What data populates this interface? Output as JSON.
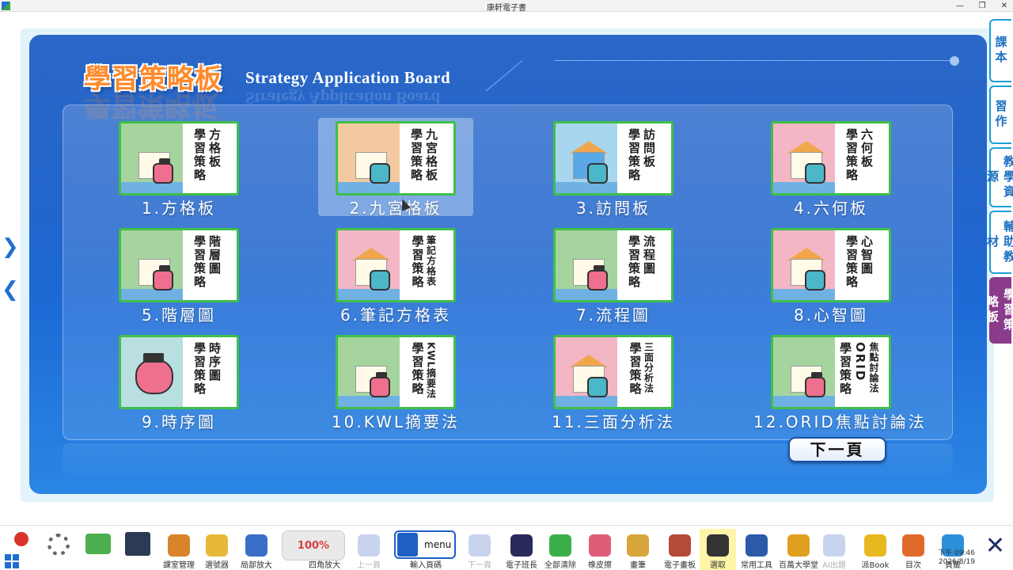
{
  "window": {
    "title": "康軒電子書"
  },
  "board": {
    "title_zh": "學習策略板",
    "title_en": "Strategy Application Board",
    "next_button": "下一頁"
  },
  "strategies": [
    {
      "label": "1.方格板",
      "thumb_cols": [
        "方格板",
        "學習策略"
      ],
      "art": "green"
    },
    {
      "label": "2.九宮格板",
      "thumb_cols": [
        "九宮格板",
        "學習策略"
      ],
      "art": "peach"
    },
    {
      "label": "3.訪問板",
      "thumb_cols": [
        "訪問板",
        "學習策略"
      ],
      "art": "blue"
    },
    {
      "label": "4.六何板",
      "thumb_cols": [
        "六何板",
        "學習策略"
      ],
      "art": "pink"
    },
    {
      "label": "5.階層圖",
      "thumb_cols": [
        "階層圖",
        "學習策略"
      ],
      "art": "green"
    },
    {
      "label": "6.筆記方格表",
      "thumb_cols": [
        "筆記方格表",
        "學習策略"
      ],
      "art": "pink"
    },
    {
      "label": "7.流程圖",
      "thumb_cols": [
        "流程圖",
        "學習策略"
      ],
      "art": "green"
    },
    {
      "label": "8.心智圖",
      "thumb_cols": [
        "心智圖",
        "學習策略"
      ],
      "art": "pink"
    },
    {
      "label": "9.時序圖",
      "thumb_cols": [
        "時序圖",
        "學習策略"
      ],
      "art": "teal"
    },
    {
      "label": "10.KWL摘要法",
      "thumb_cols": [
        "KWL摘要法",
        "學習策略"
      ],
      "art": "green"
    },
    {
      "label": "11.三面分析法",
      "thumb_cols": [
        "三面分析法",
        "學習策略"
      ],
      "art": "pink"
    },
    {
      "label": "12.ORID焦點討論法",
      "thumb_cols": [
        "焦點討論法",
        "ORID",
        "學習策略"
      ],
      "art": "green"
    }
  ],
  "side_arrows": {
    "next": "❯",
    "prev": "❮"
  },
  "right_tabs": [
    {
      "label": "課本"
    },
    {
      "label": "習作"
    },
    {
      "label": "教學資源"
    },
    {
      "label": "輔助教材"
    },
    {
      "label": "學習策略板"
    }
  ],
  "taskbar": {
    "tools": [
      {
        "label": "課室管理",
        "color": "#d9832a"
      },
      {
        "label": "選號器",
        "color": "#e7b93a"
      },
      {
        "label": "局部放大",
        "color": "#3a6fc9"
      },
      {
        "label": "四角放大",
        "color": "#cc3b3b"
      },
      {
        "label": "上一頁",
        "color": "#c8d4ee"
      },
      {
        "label": "輸入頁碼",
        "color": "#1f5fc4"
      },
      {
        "label": "下一頁",
        "color": "#c8d4ee"
      },
      {
        "label": "電子班長",
        "color": "#2a2a5a"
      },
      {
        "label": "全部清除",
        "color": "#3bb04a"
      },
      {
        "label": "橡皮擦",
        "color": "#e05d7a"
      },
      {
        "label": "畫筆",
        "color": "#d8a53a"
      },
      {
        "label": "電子畫板",
        "color": "#b54a3a"
      },
      {
        "label": "選取",
        "color": "#333333"
      },
      {
        "label": "常用工具",
        "color": "#2a5aa8"
      },
      {
        "label": "百萬大學堂",
        "color": "#e0a020"
      },
      {
        "label": "AI出題",
        "color": "#c8d4ee"
      },
      {
        "label": "派Book",
        "color": "#e8b820"
      },
      {
        "label": "目次",
        "color": "#e06a2a"
      },
      {
        "label": "頁籤",
        "color": "#2a8fd8"
      }
    ],
    "page_zoom": "100%",
    "menu_label": "menu",
    "clock_time": "下午 09:46",
    "clock_date": "2026/8/19",
    "close": "✕"
  }
}
